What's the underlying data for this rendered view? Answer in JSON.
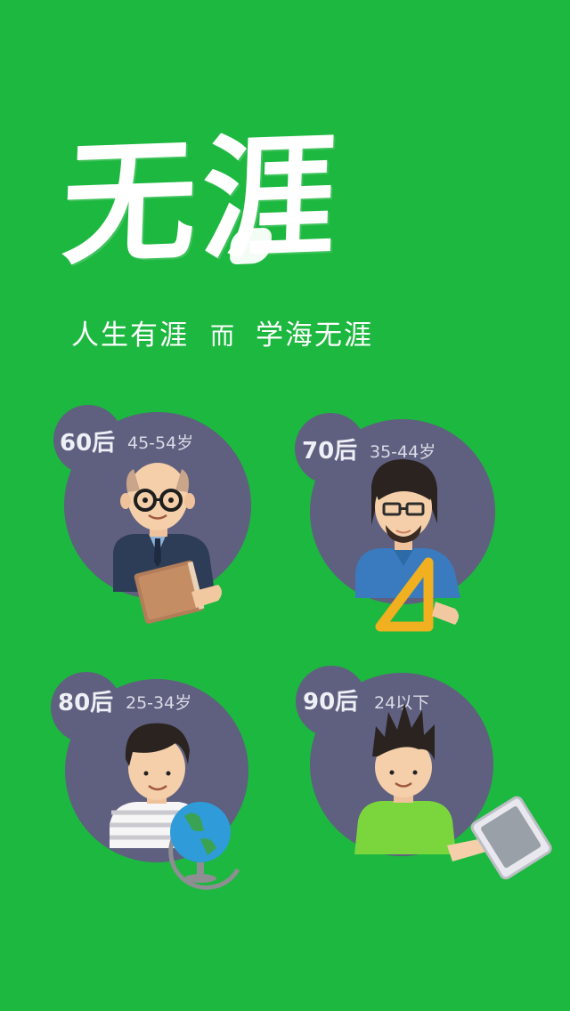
{
  "colors": {
    "background": "#1db83f",
    "circle": "#5f5f7f"
  },
  "title": "无涯",
  "slogan": {
    "part1": "人生有涯",
    "connector": "而",
    "part2": "学海无涯"
  },
  "groups": [
    {
      "generation": "60后",
      "age_range": "45-54岁",
      "icon": "book-icon"
    },
    {
      "generation": "70后",
      "age_range": "35-44岁",
      "icon": "triangle-ruler-icon"
    },
    {
      "generation": "80后",
      "age_range": "25-34岁",
      "icon": "globe-icon"
    },
    {
      "generation": "90后",
      "age_range": "24以下",
      "icon": "tablet-icon"
    }
  ]
}
